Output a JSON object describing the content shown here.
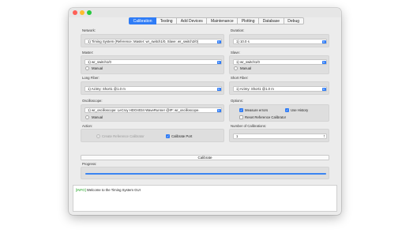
{
  "tabs": [
    {
      "label": "Calibration",
      "active": true
    },
    {
      "label": "Testing",
      "active": false
    },
    {
      "label": "Add Devices",
      "active": false
    },
    {
      "label": "Maintenance",
      "active": false
    },
    {
      "label": "Plotting",
      "active": false
    },
    {
      "label": "Database",
      "active": false
    },
    {
      "label": "Debug",
      "active": false
    }
  ],
  "network": {
    "label": "Network:",
    "value": "1) Timing System (Reference: Master: wr_switch1/0, Slave: wr_switch2/0)"
  },
  "duration": {
    "label": "Duration:",
    "value": "1) 10.0 s"
  },
  "master": {
    "label": "Master:",
    "value": "1) wr_switch1/0",
    "manual_label": "Manual"
  },
  "slave": {
    "label": "Slave:",
    "value": "1) wr_switch1/0",
    "manual_label": "Manual"
  },
  "long_fiber": {
    "label": "Long Fiber:",
    "value": "1) Azimy: Short1 @1.0 m"
  },
  "short_fiber": {
    "label": "Short Fiber:",
    "value": "1) Azimy: Short1 @1.0 m"
  },
  "oscilloscope": {
    "label": "Oscilloscope:",
    "value": "1) wr_oscilloscope: LeCroy HDO4034 WaveRunner @IP: wr_oscilloscope.",
    "manual_label": "Manual"
  },
  "options": {
    "label": "Options:",
    "measure_errors": {
      "label": "Measure errors",
      "checked": true
    },
    "use_history": {
      "label": "Use History",
      "checked": true
    },
    "reset_reference": {
      "label": "Reset Reference Calibrator",
      "checked": false
    }
  },
  "action": {
    "label": "Action:",
    "create_reference": {
      "label": "Create Reference Calibrator",
      "enabled": false
    },
    "calibrate_port": {
      "label": "Calibrate Port",
      "checked": true
    }
  },
  "num_calibrations": {
    "label": "Number of Calibrations:",
    "value": "1"
  },
  "calibrate_button": {
    "label": "Calibrate"
  },
  "progress": {
    "label": "Progress:",
    "value": 1.0
  },
  "log": {
    "tag": "[INFO]",
    "message": " Welcome to the Timing System GUI"
  },
  "colors": {
    "accent": "#2f7cf6",
    "info": "#19a01b"
  }
}
